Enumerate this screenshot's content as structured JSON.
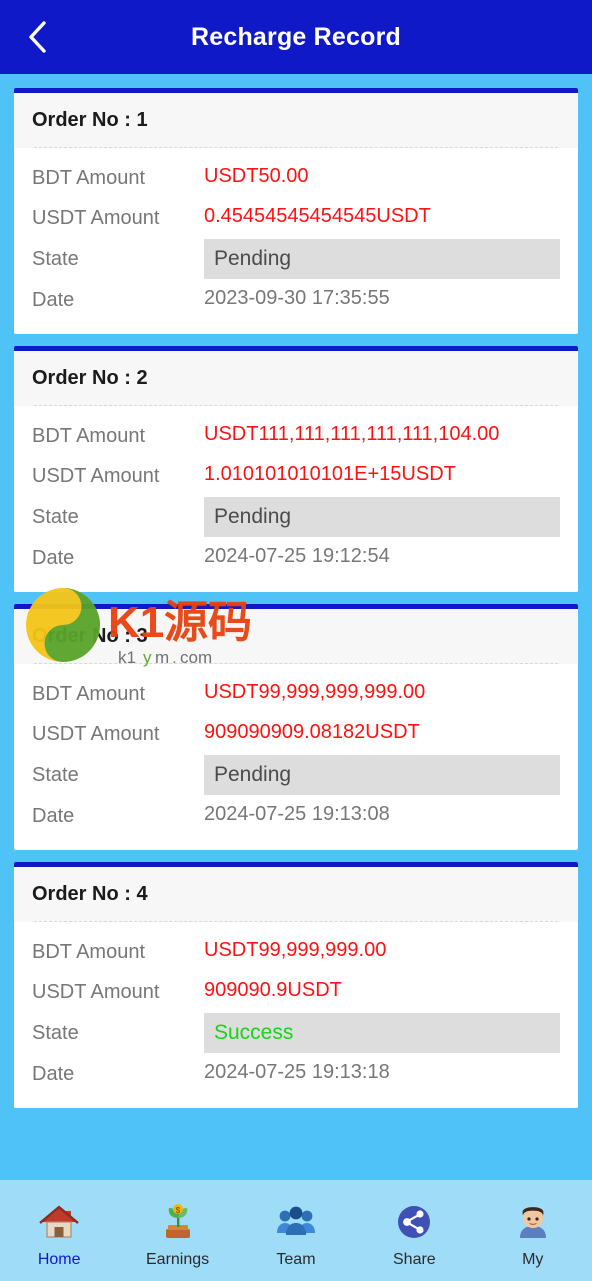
{
  "header": {
    "title": "Recharge Record",
    "back_icon": "chevron-left-icon"
  },
  "labels": {
    "bdt_amount": "BDT Amount",
    "usdt_amount": "USDT Amount",
    "state": "State",
    "date": "Date"
  },
  "colors": {
    "header_bg": "#1019C8",
    "page_bg": "#4FC3F7",
    "card_accent": "#1019C8",
    "amount_red": "#FF1111",
    "state_bg": "#DDDDDD",
    "success_green": "#19D219",
    "tabbar_bg": "#9FDCF8",
    "tab_active": "#1019C8"
  },
  "records": [
    {
      "order_no": "Order No : 1",
      "bdt_amount": "USDT50.00",
      "usdt_amount": "0.45454545454545USDT",
      "state": "Pending",
      "state_type": "pending",
      "date": "2023-09-30 17:35:55"
    },
    {
      "order_no": "Order No : 2",
      "bdt_amount": "USDT111,111,111,111,111,104.00",
      "usdt_amount": "1.010101010101E+15USDT",
      "state": "Pending",
      "state_type": "pending",
      "date": "2024-07-25 19:12:54"
    },
    {
      "order_no": "Order No : 3",
      "bdt_amount": "USDT99,999,999,999.00",
      "usdt_amount": "909090909.08182USDT",
      "state": "Pending",
      "state_type": "pending",
      "date": "2024-07-25 19:13:08"
    },
    {
      "order_no": "Order No : 4",
      "bdt_amount": "USDT99,999,999.00",
      "usdt_amount": "909090.9USDT",
      "state": "Success",
      "state_type": "success",
      "date": "2024-07-25 19:13:18"
    }
  ],
  "watermark": {
    "text": "K1源码",
    "sub_text": "k1ym.com"
  },
  "tabbar": {
    "items": [
      {
        "label": "Home",
        "icon": "house-icon",
        "active": true
      },
      {
        "label": "Earnings",
        "icon": "money-plant-icon",
        "active": false
      },
      {
        "label": "Team",
        "icon": "people-group-icon",
        "active": false
      },
      {
        "label": "Share",
        "icon": "share-network-icon",
        "active": false
      },
      {
        "label": "My",
        "icon": "user-avatar-icon",
        "active": false
      }
    ]
  }
}
